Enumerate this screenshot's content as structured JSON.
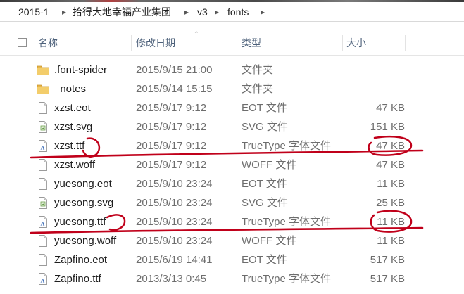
{
  "breadcrumb": {
    "items": [
      "2015-1",
      "拾得大地幸福产业集团",
      "v3",
      "fonts"
    ]
  },
  "columns": {
    "name": "名称",
    "date": "修改日期",
    "type": "类型",
    "size": "大小"
  },
  "files": [
    {
      "name": ".font-spider",
      "date": "2015/9/15 21:00",
      "type": "文件夹",
      "size": "",
      "icon": "folder-icon"
    },
    {
      "name": "_notes",
      "date": "2015/9/14 15:15",
      "type": "文件夹",
      "size": "",
      "icon": "folder-icon"
    },
    {
      "name": "xzst.eot",
      "date": "2015/9/17 9:12",
      "type": "EOT 文件",
      "size": "47 KB",
      "icon": "generic-file-icon"
    },
    {
      "name": "xzst.svg",
      "date": "2015/9/17 9:12",
      "type": "SVG 文件",
      "size": "151 KB",
      "icon": "svg-file-icon"
    },
    {
      "name": "xzst.ttf",
      "date": "2015/9/17 9:12",
      "type": "TrueType 字体文件",
      "size": "47 KB",
      "icon": "font-file-icon"
    },
    {
      "name": "xzst.woff",
      "date": "2015/9/17 9:12",
      "type": "WOFF 文件",
      "size": "47 KB",
      "icon": "generic-file-icon"
    },
    {
      "name": "yuesong.eot",
      "date": "2015/9/10 23:24",
      "type": "EOT 文件",
      "size": "11 KB",
      "icon": "generic-file-icon"
    },
    {
      "name": "yuesong.svg",
      "date": "2015/9/10 23:24",
      "type": "SVG 文件",
      "size": "25 KB",
      "icon": "svg-file-icon"
    },
    {
      "name": "yuesong.ttf",
      "date": "2015/9/10 23:24",
      "type": "TrueType 字体文件",
      "size": "11 KB",
      "icon": "font-file-icon"
    },
    {
      "name": "yuesong.woff",
      "date": "2015/9/10 23:24",
      "type": "WOFF 文件",
      "size": "11 KB",
      "icon": "generic-file-icon"
    },
    {
      "name": "Zapfino.eot",
      "date": "2015/6/19 14:41",
      "type": "EOT 文件",
      "size": "517 KB",
      "icon": "generic-file-icon"
    },
    {
      "name": "Zapfino.ttf",
      "date": "2013/3/13 0:45",
      "type": "TrueType 字体文件",
      "size": "517 KB",
      "icon": "font-file-icon"
    }
  ],
  "colors": {
    "header_text": "#4c607a",
    "annotation": "#c0001a",
    "folder": "#e8b64a"
  }
}
